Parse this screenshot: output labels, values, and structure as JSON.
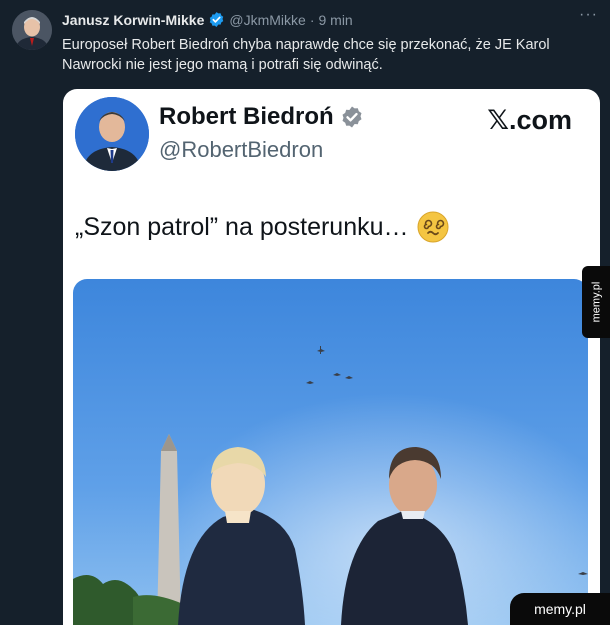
{
  "tweet": {
    "author_name": "Janusz Korwin-Mikke",
    "handle": "@JkmMikke",
    "separator": "·",
    "time": "9 min",
    "more": "···",
    "text": "Europoseł Robert Biedroń chyba naprawdę chce się przekonać, że JE Karol Nawrocki nie jest jego mamą i potrafi się odwinąć."
  },
  "quoted": {
    "name": "Robert Biedroń",
    "handle": "@RobertBiedron",
    "source": "𝕏.com",
    "text": "„Szon patrol” na posterunku…",
    "emoji": "dizzy-face-icon"
  },
  "watermarks": {
    "side": "memy.pl",
    "corner": "memy.pl"
  },
  "colors": {
    "background": "#15202b",
    "verified": "#1d9bf0",
    "muted": "#8b98a5",
    "sky": "#4a90e0"
  }
}
